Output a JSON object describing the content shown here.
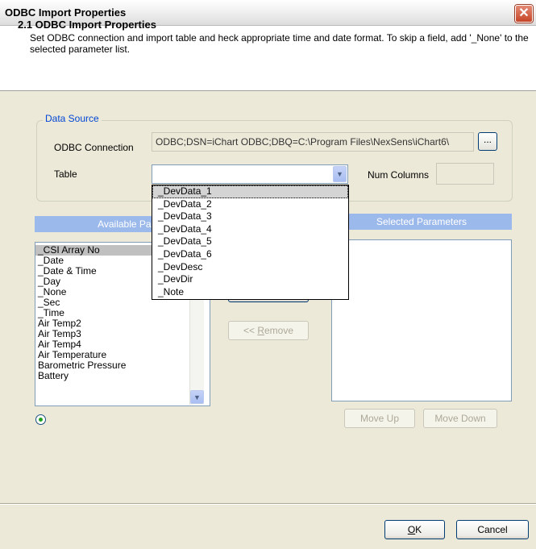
{
  "window": {
    "title": "ODBC Import Properties",
    "close_glyph": "✕"
  },
  "header": {
    "title": "2.1 ODBC Import Properties",
    "description": "Set ODBC connection and import table and heck appropriate time and date format.  To skip a field, add '_None' to the selected parameter list."
  },
  "data_source": {
    "legend": "Data Source",
    "odbc_label": "ODBC Connection",
    "odbc_value": "ODBC;DSN=iChart ODBC;DBQ=C:\\Program Files\\NexSens\\iChart6\\",
    "browse_label": "...",
    "table_label": "Table",
    "table_value": "",
    "num_columns_label": "Num Columns",
    "num_columns_value": ""
  },
  "table_dropdown": {
    "items": [
      "_DevData_1",
      "_DevData_2",
      "_DevData_3",
      "_DevData_4",
      "_DevData_5",
      "_DevData_6",
      "_DevDesc",
      "_DevDir",
      "_Note"
    ],
    "focused_index": 0
  },
  "available": {
    "header": "Available Parame",
    "items": [
      "_CSI Array No",
      "_Date",
      "_Date & Time",
      "_Day",
      "_None",
      "_Sec",
      "_Time",
      "Air Temp2",
      "Air Temp3",
      "Air Temp4",
      "Air Temperature",
      "Barometric Pressure",
      "Battery"
    ],
    "selected_index": 0
  },
  "selected": {
    "header": "Selected Parameters",
    "items": []
  },
  "buttons": {
    "remove": "<< Remove",
    "move_up": "Move Up",
    "move_down": "Move Down",
    "ok": "OK",
    "cancel": "Cancel"
  },
  "icons": {
    "close": "close-icon",
    "dropdown_arrow": "chevron-down-icon",
    "scroll_down": "chevron-down-icon",
    "radio": "radio-selected-icon"
  },
  "colors": {
    "dialog_bg": "#ece9d8",
    "section_header": "#9cb9eb",
    "legend_text": "#0046d5",
    "close_button": "#c54527"
  }
}
